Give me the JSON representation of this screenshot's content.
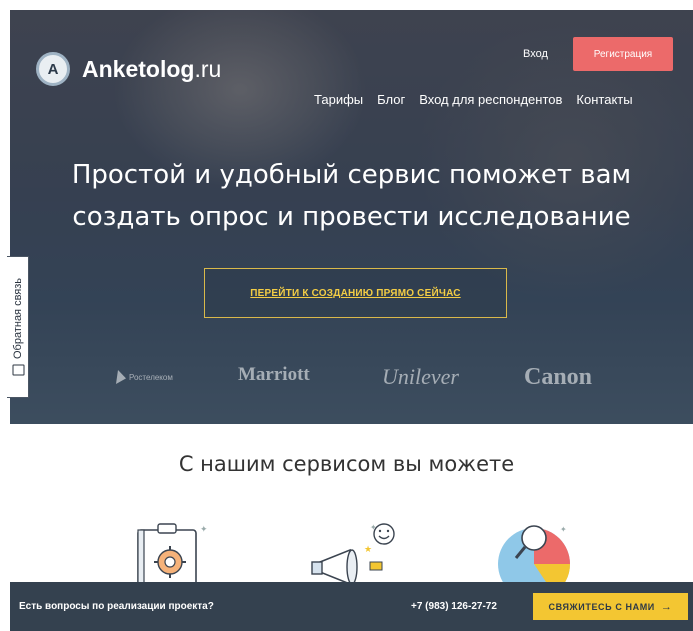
{
  "header": {
    "logo_letter": "A",
    "brand_name": "Anketolog",
    "brand_domain": ".ru",
    "login_label": "Вход",
    "register_label": "Регистрация",
    "nav": [
      {
        "label": "Тарифы"
      },
      {
        "label": "Блог"
      },
      {
        "label": "Вход для респондентов"
      },
      {
        "label": "Контакты"
      }
    ]
  },
  "hero": {
    "headline_line1": "Простой и удобный сервис поможет вам",
    "headline_line2": "создать опрос и провести исследование",
    "cta_label": "ПЕРЕЙТИ К СОЗДАНИЮ ПРЯМО СЕЙЧАС",
    "brands": [
      "Ростелеком",
      "Marriott",
      "Unilever",
      "Canon"
    ]
  },
  "feedback_tab": {
    "label": "Обратная связь"
  },
  "features": {
    "title": "С нашим сервисом вы можете"
  },
  "footer_bar": {
    "question": "Есть вопросы по реализации проекта?",
    "phone": "+7 (983) 126-27-72",
    "contact_label": "СВЯЖИТЕСЬ С НАМИ",
    "contact_arrow": "→"
  },
  "colors": {
    "accent_red": "#ec6a6a",
    "accent_yellow": "#f3c632",
    "dark_bar": "#34414f"
  }
}
